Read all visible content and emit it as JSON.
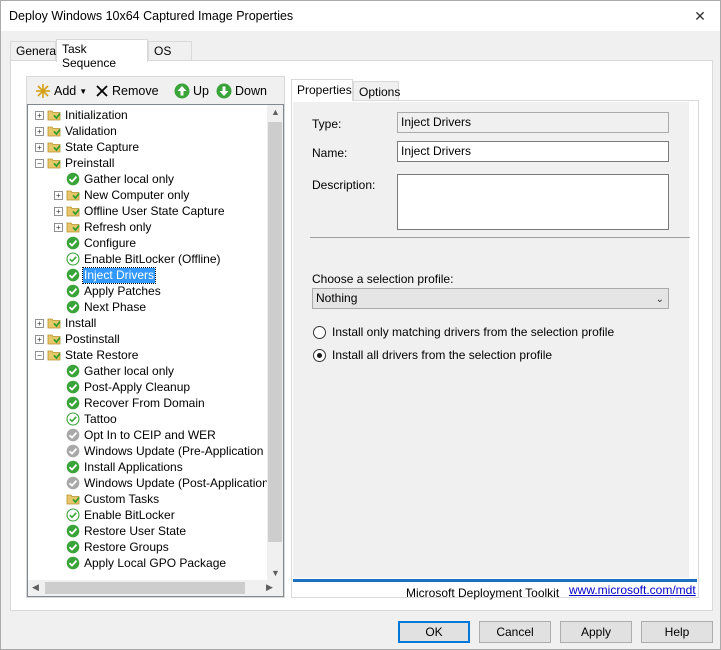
{
  "window": {
    "title": "Deploy Windows 10x64 Captured Image Properties",
    "close_glyph": "✕"
  },
  "tabs": [
    {
      "label": "General",
      "active": false
    },
    {
      "label": "Task Sequence",
      "active": true
    },
    {
      "label": "OS Info",
      "active": false
    }
  ],
  "toolbar": {
    "add_label": "Add",
    "add_icon": "sparkle-icon",
    "remove_label": "Remove",
    "up_label": "Up",
    "down_label": "Down"
  },
  "tree": {
    "items": [
      {
        "label": "Initialization",
        "level": 0,
        "expander": "+",
        "icon": "folder"
      },
      {
        "label": "Validation",
        "level": 0,
        "expander": "+",
        "icon": "folder"
      },
      {
        "label": "State Capture",
        "level": 0,
        "expander": "+",
        "icon": "folder"
      },
      {
        "label": "Preinstall",
        "level": 0,
        "expander": "-",
        "icon": "folder"
      },
      {
        "label": "Gather local only",
        "level": 1,
        "expander": "",
        "icon": "check"
      },
      {
        "label": "New Computer only",
        "level": 1,
        "expander": "+",
        "icon": "folder"
      },
      {
        "label": "Offline User State Capture",
        "level": 1,
        "expander": "+",
        "icon": "folder"
      },
      {
        "label": "Refresh only",
        "level": 1,
        "expander": "+",
        "icon": "folder"
      },
      {
        "label": "Configure",
        "level": 1,
        "expander": "",
        "icon": "check"
      },
      {
        "label": "Enable BitLocker (Offline)",
        "level": 1,
        "expander": "",
        "icon": "check-outline"
      },
      {
        "label": "Inject Drivers",
        "level": 1,
        "expander": "",
        "icon": "check",
        "selected": true
      },
      {
        "label": "Apply Patches",
        "level": 1,
        "expander": "",
        "icon": "check"
      },
      {
        "label": "Next Phase",
        "level": 1,
        "expander": "",
        "icon": "check"
      },
      {
        "label": "Install",
        "level": 0,
        "expander": "+",
        "icon": "folder"
      },
      {
        "label": "Postinstall",
        "level": 0,
        "expander": "+",
        "icon": "folder"
      },
      {
        "label": "State Restore",
        "level": 0,
        "expander": "-",
        "icon": "folder"
      },
      {
        "label": "Gather local only",
        "level": 1,
        "expander": "",
        "icon": "check"
      },
      {
        "label": "Post-Apply Cleanup",
        "level": 1,
        "expander": "",
        "icon": "check"
      },
      {
        "label": "Recover From Domain",
        "level": 1,
        "expander": "",
        "icon": "check"
      },
      {
        "label": "Tattoo",
        "level": 1,
        "expander": "",
        "icon": "check-outline"
      },
      {
        "label": "Opt In to CEIP and WER",
        "level": 1,
        "expander": "",
        "icon": "disabled"
      },
      {
        "label": "Windows Update (Pre-Application Inst",
        "level": 1,
        "expander": "",
        "icon": "disabled"
      },
      {
        "label": "Install Applications",
        "level": 1,
        "expander": "",
        "icon": "check"
      },
      {
        "label": "Windows Update (Post-Application Ins",
        "level": 1,
        "expander": "",
        "icon": "disabled"
      },
      {
        "label": "Custom Tasks",
        "level": 1,
        "expander": "",
        "icon": "folder"
      },
      {
        "label": "Enable BitLocker",
        "level": 1,
        "expander": "",
        "icon": "check-outline"
      },
      {
        "label": "Restore User State",
        "level": 1,
        "expander": "",
        "icon": "check"
      },
      {
        "label": "Restore Groups",
        "level": 1,
        "expander": "",
        "icon": "check"
      },
      {
        "label": "Apply Local GPO Package",
        "level": 1,
        "expander": "",
        "icon": "check"
      }
    ]
  },
  "inner_tabs": [
    {
      "label": "Properties",
      "active": true
    },
    {
      "label": "Options",
      "active": false
    }
  ],
  "properties": {
    "type_label": "Type:",
    "type_value": "Inject Drivers",
    "name_label": "Name:",
    "name_value": "Inject Drivers",
    "description_label": "Description:",
    "description_value": "",
    "profile_label": "Choose a selection profile:",
    "profile_value": "Nothing",
    "radio_matching": "Install only matching drivers from the selection profile",
    "radio_all": "Install all drivers from the selection profile",
    "selected_radio": "all"
  },
  "footer": {
    "brand": "Microsoft Deployment Toolkit",
    "link": "www.microsoft.com/mdt",
    "accent": "#1d6fbf"
  },
  "buttons": {
    "ok": "OK",
    "cancel": "Cancel",
    "apply": "Apply",
    "help": "Help"
  }
}
